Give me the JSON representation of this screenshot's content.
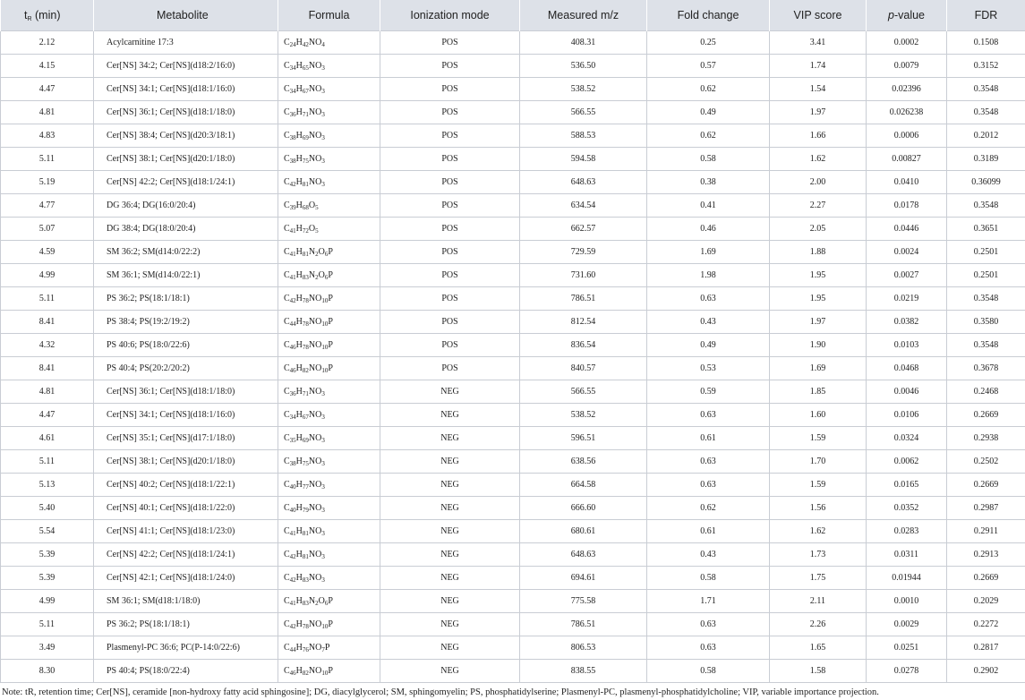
{
  "headers": {
    "tr_main": "t",
    "tr_sub": "R",
    "tr_unit": " (min)",
    "metabolite": "Metabolite",
    "formula": "Formula",
    "ionization": "Ionization mode",
    "mz": "Measured m/z",
    "fold": "Fold change",
    "vip": "VIP score",
    "p_italic": "p",
    "p_rest": "-value",
    "fdr": "FDR"
  },
  "rows": [
    {
      "tr": "2.12",
      "met": "Acylcarnitine 17:3",
      "formula": [
        [
          "C",
          "24"
        ],
        [
          "H",
          "42"
        ],
        [
          "NO",
          "4"
        ]
      ],
      "mode": "POS",
      "mz": "408.31",
      "fold": "0.25",
      "vip": "3.41",
      "p": "0.0002",
      "fdr": "0.1508"
    },
    {
      "tr": "4.15",
      "met": "Cer[NS] 34:2; Cer[NS](d18:2/16:0)",
      "formula": [
        [
          "C",
          "34"
        ],
        [
          "H",
          "65"
        ],
        [
          "NO",
          "3"
        ]
      ],
      "mode": "POS",
      "mz": "536.50",
      "fold": "0.57",
      "vip": "1.74",
      "p": "0.0079",
      "fdr": "0.3152"
    },
    {
      "tr": "4.47",
      "met": "Cer[NS] 34:1; Cer[NS](d18:1/16:0)",
      "formula": [
        [
          "C",
          "34"
        ],
        [
          "H",
          "67"
        ],
        [
          "NO",
          "3"
        ]
      ],
      "mode": "POS",
      "mz": "538.52",
      "fold": "0.62",
      "vip": "1.54",
      "p": "0.02396",
      "fdr": "0.3548"
    },
    {
      "tr": "4.81",
      "met": "Cer[NS] 36:1; Cer[NS](d18:1/18:0)",
      "formula": [
        [
          "C",
          "36"
        ],
        [
          "H",
          "71"
        ],
        [
          "NO",
          "3"
        ]
      ],
      "mode": "POS",
      "mz": "566.55",
      "fold": "0.49",
      "vip": "1.97",
      "p": "0.026238",
      "fdr": "0.3548"
    },
    {
      "tr": "4.83",
      "met": "Cer[NS] 38:4; Cer[NS](d20:3/18:1)",
      "formula": [
        [
          "C",
          "38"
        ],
        [
          "H",
          "69"
        ],
        [
          "NO",
          "3"
        ]
      ],
      "mode": "POS",
      "mz": "588.53",
      "fold": "0.62",
      "vip": "1.66",
      "p": "0.0006",
      "fdr": "0.2012"
    },
    {
      "tr": "5.11",
      "met": "Cer[NS] 38:1; Cer[NS](d20:1/18:0)",
      "formula": [
        [
          "C",
          "38"
        ],
        [
          "H",
          "75"
        ],
        [
          "NO",
          "3"
        ]
      ],
      "mode": "POS",
      "mz": "594.58",
      "fold": "0.58",
      "vip": "1.62",
      "p": "0.00827",
      "fdr": "0.3189"
    },
    {
      "tr": "5.19",
      "met": "Cer[NS] 42:2; Cer[NS](d18:1/24:1)",
      "formula": [
        [
          "C",
          "42"
        ],
        [
          "H",
          "81"
        ],
        [
          "NO",
          "3"
        ]
      ],
      "mode": "POS",
      "mz": "648.63",
      "fold": "0.38",
      "vip": "2.00",
      "p": "0.0410",
      "fdr": "0.36099"
    },
    {
      "tr": "4.77",
      "met": "DG 36:4; DG(16:0/20:4)",
      "formula": [
        [
          "C",
          "39"
        ],
        [
          "H",
          "68"
        ],
        [
          "O",
          "5"
        ]
      ],
      "mode": "POS",
      "mz": "634.54",
      "fold": "0.41",
      "vip": "2.27",
      "p": "0.0178",
      "fdr": "0.3548"
    },
    {
      "tr": "5.07",
      "met": "DG 38:4; DG(18:0/20:4)",
      "formula": [
        [
          "C",
          "41"
        ],
        [
          "H",
          "72"
        ],
        [
          "O",
          "5"
        ]
      ],
      "mode": "POS",
      "mz": "662.57",
      "fold": "0.46",
      "vip": "2.05",
      "p": "0.0446",
      "fdr": "0.3651"
    },
    {
      "tr": "4.59",
      "met": "SM 36:2; SM(d14:0/22:2)",
      "formula": [
        [
          "C",
          "41"
        ],
        [
          "H",
          "81"
        ],
        [
          "N",
          "2"
        ],
        [
          "O",
          "6"
        ],
        [
          "P",
          ""
        ]
      ],
      "mode": "POS",
      "mz": "729.59",
      "fold": "1.69",
      "vip": "1.88",
      "p": "0.0024",
      "fdr": "0.2501"
    },
    {
      "tr": "4.99",
      "met": "SM 36:1; SM(d14:0/22:1)",
      "formula": [
        [
          "C",
          "41"
        ],
        [
          "H",
          "83"
        ],
        [
          "N",
          "2"
        ],
        [
          "O",
          "6"
        ],
        [
          "P",
          ""
        ]
      ],
      "mode": "POS",
      "mz": "731.60",
      "fold": "1.98",
      "vip": "1.95",
      "p": "0.0027",
      "fdr": "0.2501"
    },
    {
      "tr": "5.11",
      "met": "PS 36:2; PS(18:1/18:1)",
      "formula": [
        [
          "C",
          "42"
        ],
        [
          "H",
          "78"
        ],
        [
          "NO",
          "10"
        ],
        [
          "P",
          ""
        ]
      ],
      "mode": "POS",
      "mz": "786.51",
      "fold": "0.63",
      "vip": "1.95",
      "p": "0.0219",
      "fdr": "0.3548"
    },
    {
      "tr": "8.41",
      "met": "PS 38:4; PS(19:2/19:2)",
      "formula": [
        [
          "C",
          "44"
        ],
        [
          "H",
          "78"
        ],
        [
          "NO",
          "10"
        ],
        [
          "P",
          ""
        ]
      ],
      "mode": "POS",
      "mz": "812.54",
      "fold": "0.43",
      "vip": "1.97",
      "p": "0.0382",
      "fdr": "0.3580"
    },
    {
      "tr": "4.32",
      "met": "PS 40:6; PS(18:0/22:6)",
      "formula": [
        [
          "C",
          "46"
        ],
        [
          "H",
          "78"
        ],
        [
          "NO",
          "10"
        ],
        [
          "P",
          ""
        ]
      ],
      "mode": "POS",
      "mz": "836.54",
      "fold": "0.49",
      "vip": "1.90",
      "p": "0.0103",
      "fdr": "0.3548"
    },
    {
      "tr": "8.41",
      "met": "PS 40:4; PS(20:2/20:2)",
      "formula": [
        [
          "C",
          "46"
        ],
        [
          "H",
          "82"
        ],
        [
          "NO",
          "10"
        ],
        [
          "P",
          ""
        ]
      ],
      "mode": "POS",
      "mz": "840.57",
      "fold": "0.53",
      "vip": "1.69",
      "p": "0.0468",
      "fdr": "0.3678"
    },
    {
      "tr": "4.81",
      "met": "Cer[NS] 36:1; Cer[NS](d18:1/18:0)",
      "formula": [
        [
          "C",
          "36"
        ],
        [
          "H",
          "71"
        ],
        [
          "NO",
          "3"
        ]
      ],
      "mode": "NEG",
      "mz": "566.55",
      "fold": "0.59",
      "vip": "1.85",
      "p": "0.0046",
      "fdr": "0.2468"
    },
    {
      "tr": "4.47",
      "met": "Cer[NS] 34:1; Cer[NS](d18:1/16:0)",
      "formula": [
        [
          "C",
          "34"
        ],
        [
          "H",
          "67"
        ],
        [
          "NO",
          "3"
        ]
      ],
      "mode": "NEG",
      "mz": "538.52",
      "fold": "0.63",
      "vip": "1.60",
      "p": "0.0106",
      "fdr": "0.2669"
    },
    {
      "tr": "4.61",
      "met": "Cer[NS] 35:1; Cer[NS](d17:1/18:0)",
      "formula": [
        [
          "C",
          "35"
        ],
        [
          "H",
          "69"
        ],
        [
          "NO",
          "3"
        ]
      ],
      "mode": "NEG",
      "mz": "596.51",
      "fold": "0.61",
      "vip": "1.59",
      "p": "0.0324",
      "fdr": "0.2938"
    },
    {
      "tr": "5.11",
      "met": "Cer[NS] 38:1; Cer[NS](d20:1/18:0)",
      "formula": [
        [
          "C",
          "38"
        ],
        [
          "H",
          "75"
        ],
        [
          "NO",
          "3"
        ]
      ],
      "mode": "NEG",
      "mz": "638.56",
      "fold": "0.63",
      "vip": "1.70",
      "p": "0.0062",
      "fdr": "0.2502"
    },
    {
      "tr": "5.13",
      "met": "Cer[NS] 40:2; Cer[NS](d18:1/22:1)",
      "formula": [
        [
          "C",
          "40"
        ],
        [
          "H",
          "77"
        ],
        [
          "NO",
          "3"
        ]
      ],
      "mode": "NEG",
      "mz": "664.58",
      "fold": "0.63",
      "vip": "1.59",
      "p": "0.0165",
      "fdr": "0.2669"
    },
    {
      "tr": "5.40",
      "met": "Cer[NS] 40:1; Cer[NS](d18:1/22:0)",
      "formula": [
        [
          "C",
          "40"
        ],
        [
          "H",
          "79"
        ],
        [
          "NO",
          "3"
        ]
      ],
      "mode": "NEG",
      "mz": "666.60",
      "fold": "0.62",
      "vip": "1.56",
      "p": "0.0352",
      "fdr": "0.2987"
    },
    {
      "tr": "5.54",
      "met": "Cer[NS] 41:1; Cer[NS](d18:1/23:0)",
      "formula": [
        [
          "C",
          "41"
        ],
        [
          "H",
          "81"
        ],
        [
          "NO",
          "3"
        ]
      ],
      "mode": "NEG",
      "mz": "680.61",
      "fold": "0.61",
      "vip": "1.62",
      "p": "0.0283",
      "fdr": "0.2911"
    },
    {
      "tr": "5.39",
      "met": "Cer[NS] 42:2; Cer[NS](d18:1/24:1)",
      "formula": [
        [
          "C",
          "42"
        ],
        [
          "H",
          "81"
        ],
        [
          "NO",
          "3"
        ]
      ],
      "mode": "NEG",
      "mz": "648.63",
      "fold": "0.43",
      "vip": "1.73",
      "p": "0.0311",
      "fdr": "0.2913"
    },
    {
      "tr": "5.39",
      "met": "Cer[NS] 42:1; Cer[NS](d18:1/24:0)",
      "formula": [
        [
          "C",
          "42"
        ],
        [
          "H",
          "83"
        ],
        [
          "NO",
          "3"
        ]
      ],
      "mode": "NEG",
      "mz": "694.61",
      "fold": "0.58",
      "vip": "1.75",
      "p": "0.01944",
      "fdr": "0.2669"
    },
    {
      "tr": "4.99",
      "met": "SM 36:1; SM(d18:1/18:0)",
      "formula": [
        [
          "C",
          "41"
        ],
        [
          "H",
          "83"
        ],
        [
          "N",
          "2"
        ],
        [
          "O",
          "6"
        ],
        [
          "P",
          ""
        ]
      ],
      "mode": "NEG",
      "mz": "775.58",
      "fold": "1.71",
      "vip": "2.11",
      "p": "0.0010",
      "fdr": "0.2029"
    },
    {
      "tr": "5.11",
      "met": "PS 36:2; PS(18:1/18:1)",
      "formula": [
        [
          "C",
          "42"
        ],
        [
          "H",
          "78"
        ],
        [
          "NO",
          "10"
        ],
        [
          "P",
          ""
        ]
      ],
      "mode": "NEG",
      "mz": "786.51",
      "fold": "0.63",
      "vip": "2.26",
      "p": "0.0029",
      "fdr": "0.2272"
    },
    {
      "tr": "3.49",
      "met": "Plasmenyl-PC 36:6; PC(P-14:0/22:6)",
      "formula": [
        [
          "C",
          "44"
        ],
        [
          "H",
          "76"
        ],
        [
          "NO",
          "7"
        ],
        [
          "P",
          ""
        ]
      ],
      "mode": "NEG",
      "mz": "806.53",
      "fold": "0.63",
      "vip": "1.65",
      "p": "0.0251",
      "fdr": "0.2817"
    },
    {
      "tr": "8.30",
      "met": "PS 40:4; PS(18:0/22:4)",
      "formula": [
        [
          "C",
          "46"
        ],
        [
          "H",
          "82"
        ],
        [
          "NO",
          "10"
        ],
        [
          "P",
          ""
        ]
      ],
      "mode": "NEG",
      "mz": "838.55",
      "fold": "0.58",
      "vip": "1.58",
      "p": "0.0278",
      "fdr": "0.2902"
    }
  ],
  "note": "Note: tR, retention time; Cer[NS], ceramide [non-hydroxy fatty acid sphingosine]; DG, diacylglycerol; SM, sphingomyelin; PS, phosphatidylserine; Plasmenyl-PC, plasmenyl-phosphatidylcholine; VIP, variable importance projection."
}
